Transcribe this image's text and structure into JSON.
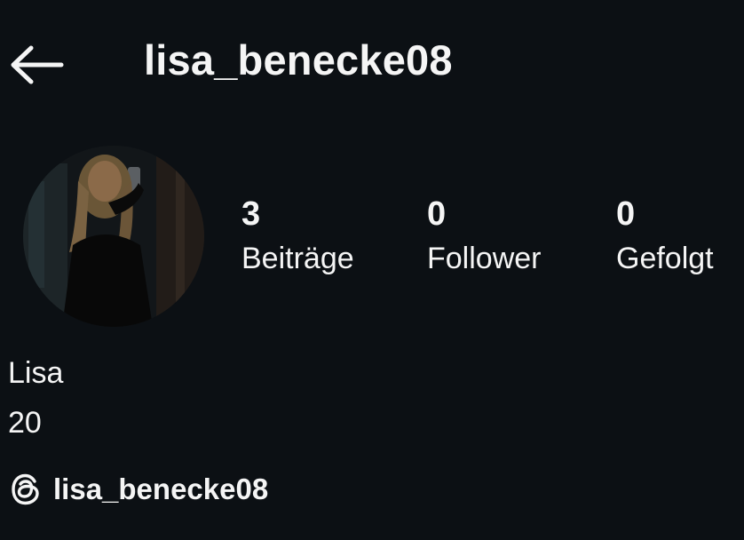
{
  "header": {
    "back_icon": "arrow-left-icon",
    "username": "lisa_benecke08"
  },
  "profile": {
    "avatar_icon": "profile-photo",
    "stats": [
      {
        "value": "3",
        "label": "Beiträge"
      },
      {
        "value": "0",
        "label": "Follower"
      },
      {
        "value": "0",
        "label": "Gefolgt"
      }
    ]
  },
  "bio": {
    "name": "Lisa",
    "line2": "20"
  },
  "threads": {
    "icon": "threads-icon",
    "handle": "lisa_benecke08"
  },
  "colors": {
    "background": "#0c1014",
    "text": "#f5f5f5"
  }
}
